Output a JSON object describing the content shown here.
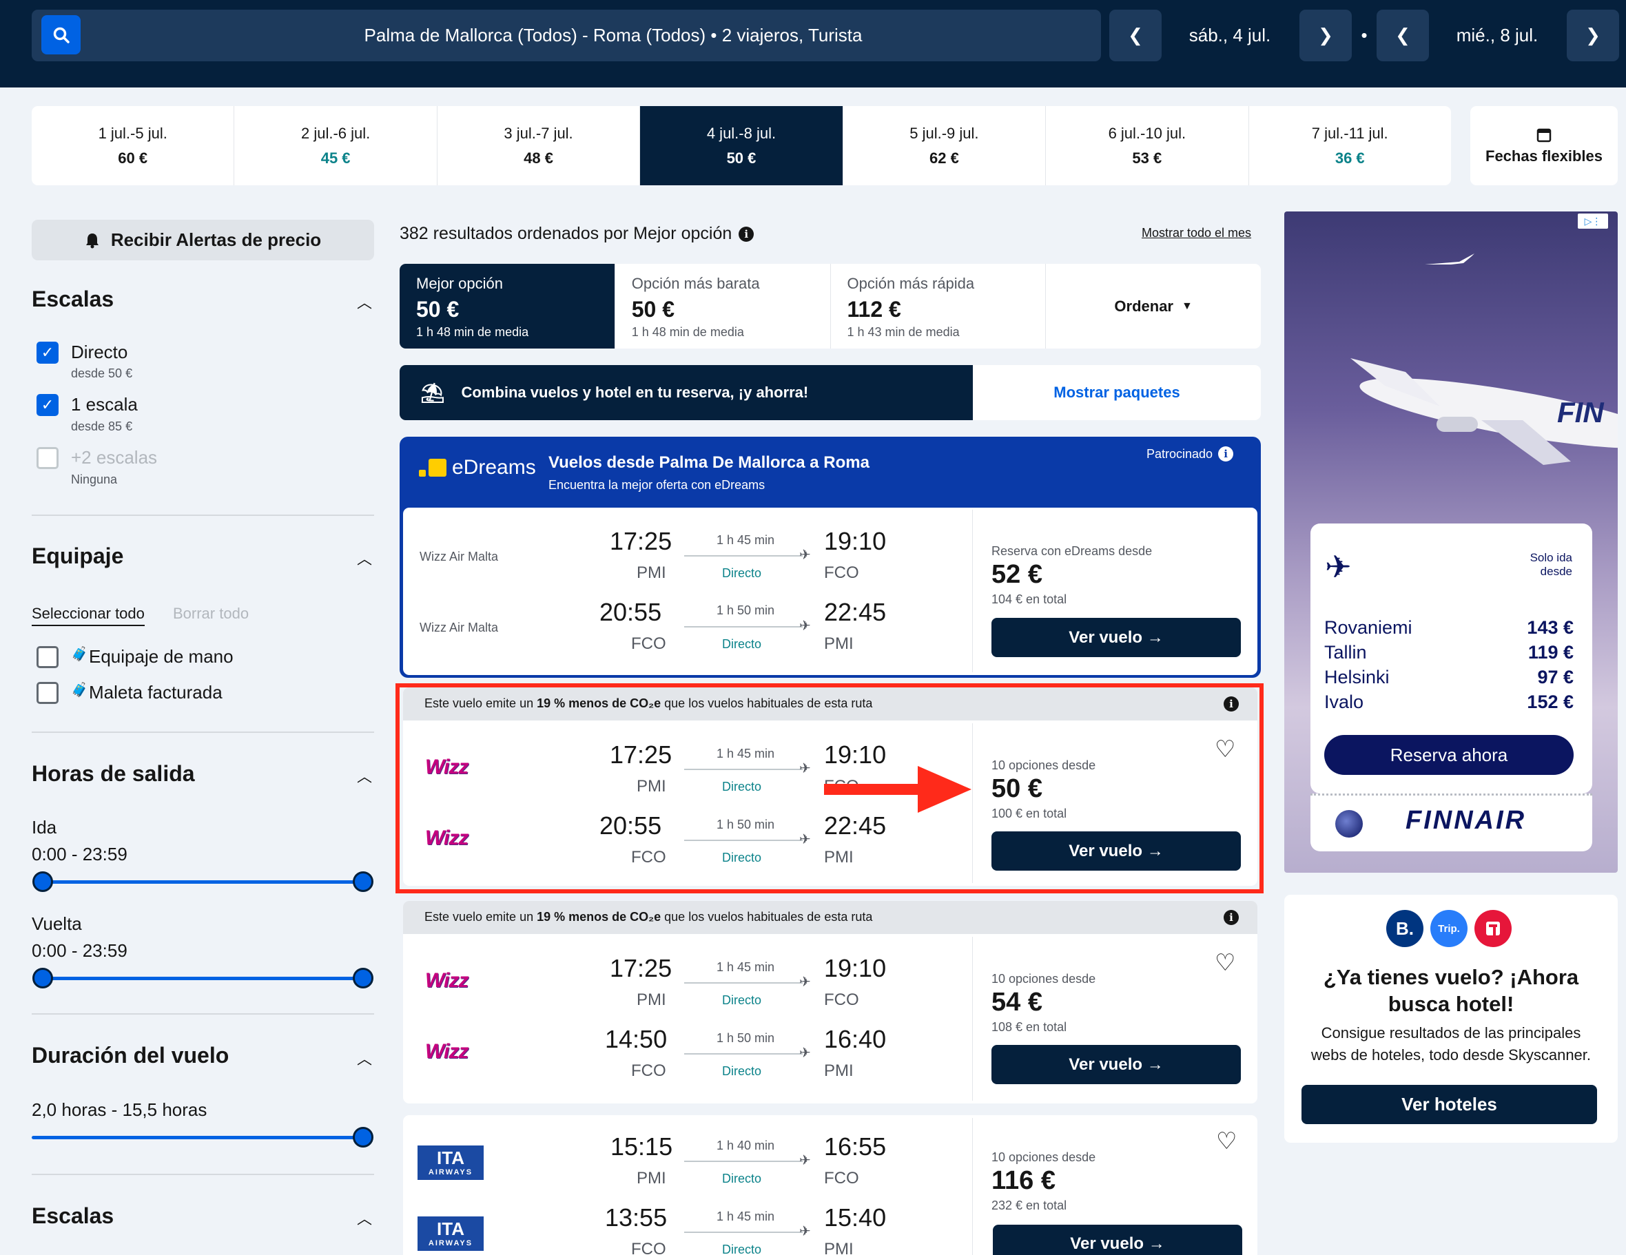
{
  "header": {
    "search_summary": "Palma de Mallorca (Todos) - Roma (Todos)  •  2 viajeros, Turista",
    "depart_date": "sáb., 4 jul.",
    "return_date": "mié., 8 jul.",
    "separator": "•"
  },
  "date_strip": [
    {
      "range": "1 jul.-5 jul.",
      "price": "60 €",
      "cheap": false,
      "active": false
    },
    {
      "range": "2 jul.-6 jul.",
      "price": "45 €",
      "cheap": true,
      "active": false
    },
    {
      "range": "3 jul.-7 jul.",
      "price": "48 €",
      "cheap": false,
      "active": false
    },
    {
      "range": "4 jul.-8 jul.",
      "price": "50 €",
      "cheap": false,
      "active": true
    },
    {
      "range": "5 jul.-9 jul.",
      "price": "62 €",
      "cheap": false,
      "active": false
    },
    {
      "range": "6 jul.-10 jul.",
      "price": "53 €",
      "cheap": false,
      "active": false
    },
    {
      "range": "7 jul.-11 jul.",
      "price": "36 €",
      "cheap": true,
      "active": false
    }
  ],
  "flex_dates_label": "Fechas flexibles",
  "sidebar": {
    "alert_label": "Recibir Alertas de precio",
    "stops_title": "Escalas",
    "stops": [
      {
        "label": "Directo",
        "sub": "desde 50 €",
        "state": "on"
      },
      {
        "label": "1 escala",
        "sub": "desde 85 €",
        "state": "on"
      },
      {
        "label": "+2 escalas",
        "sub": "Ninguna",
        "state": "disabled"
      }
    ],
    "baggage_title": "Equipaje",
    "select_all": "Seleccionar todo",
    "clear_all": "Borrar todo",
    "baggage": [
      {
        "label": "Equipaje de mano"
      },
      {
        "label": "Maleta facturada"
      }
    ],
    "times_title": "Horas de salida",
    "outbound_label": "Ida",
    "outbound_range": "0:00 - 23:59",
    "return_label": "Vuelta",
    "return_range": "0:00 - 23:59",
    "duration_title": "Duración del vuelo",
    "duration_range": "2,0 horas - 15,5 horas",
    "stops2_title": "Escalas"
  },
  "results": {
    "summary": "382 resultados ordenados por Mejor opción",
    "show_month": "Mostrar todo el mes",
    "tabs": [
      {
        "title": "Mejor opción",
        "price": "50 €",
        "sub": "1 h 48 min de media",
        "active": true
      },
      {
        "title": "Opción más barata",
        "price": "50 €",
        "sub": "1 h 48 min de media",
        "active": false
      },
      {
        "title": "Opción más rápida",
        "price": "112 €",
        "sub": "1 h 43 min de media",
        "active": false
      }
    ],
    "sort_label": "Ordenar",
    "combo_text": "Combina vuelos y hotel en tu reserva, ¡y ahorra!",
    "combo_cta": "Mostrar paquetes",
    "sponsored": {
      "brand": "eDreams",
      "title": "Vuelos desde Palma De Mallorca a Roma",
      "subtitle": "Encuentra la mejor oferta con eDreams",
      "tag": "Patrocinado",
      "legs": [
        {
          "airline": "Wizz Air Malta",
          "dep": "17:25",
          "dep_code": "PMI",
          "dur": "1 h 45 min",
          "stops": "Directo",
          "arr": "19:10",
          "arr_code": "FCO"
        },
        {
          "airline": "Wizz Air Malta",
          "dep": "20:55",
          "dep_code": "FCO",
          "dur": "1 h 50 min",
          "stops": "Directo",
          "arr": "22:45",
          "arr_code": "PMI"
        }
      ],
      "price_label": "Reserva con eDreams desde",
      "price": "52 €",
      "total": "104 € en total",
      "cta": "Ver vuelo →"
    },
    "co2_prefix": "Este vuelo emite un ",
    "co2_bold": "19 % menos de CO₂e",
    "co2_suffix": " que los vuelos habituales de esta ruta",
    "cards": [
      {
        "legs": [
          {
            "logo": "wizz",
            "dep": "17:25",
            "dep_code": "PMI",
            "dur": "1 h 45 min",
            "stops": "Directo",
            "arr": "19:10",
            "arr_code": "FCO"
          },
          {
            "logo": "wizz",
            "dep": "20:55",
            "dep_code": "FCO",
            "dur": "1 h 50 min",
            "stops": "Directo",
            "arr": "22:45",
            "arr_code": "PMI"
          }
        ],
        "options": "10 opciones desde",
        "price": "50 €",
        "total": "100 € en total",
        "cta": "Ver vuelo →"
      },
      {
        "legs": [
          {
            "logo": "wizz",
            "dep": "17:25",
            "dep_code": "PMI",
            "dur": "1 h 45 min",
            "stops": "Directo",
            "arr": "19:10",
            "arr_code": "FCO"
          },
          {
            "logo": "wizz",
            "dep": "14:50",
            "dep_code": "FCO",
            "dur": "1 h 50 min",
            "stops": "Directo",
            "arr": "16:40",
            "arr_code": "PMI"
          }
        ],
        "options": "10 opciones desde",
        "price": "54 €",
        "total": "108 € en total",
        "cta": "Ver vuelo →"
      },
      {
        "legs": [
          {
            "logo": "ita",
            "dep": "15:15",
            "dep_code": "PMI",
            "dur": "1 h 40 min",
            "stops": "Directo",
            "arr": "16:55",
            "arr_code": "FCO"
          },
          {
            "logo": "ita",
            "dep": "13:55",
            "dep_code": "FCO",
            "dur": "1 h 45 min",
            "stops": "Directo",
            "arr": "15:40",
            "arr_code": "PMI"
          }
        ],
        "options": "10 opciones desde",
        "price": "116 €",
        "total": "232 € en total",
        "cta": "Ver vuelo →"
      }
    ],
    "wizz_logo_text": "Wizz",
    "ita_logo_text": "ITA",
    "ita_logo_sub": "AIRWAYS"
  },
  "ad": {
    "only_way": "Solo ida",
    "from": "desde",
    "destinations": [
      {
        "city": "Rovaniemi",
        "price": "143 €"
      },
      {
        "city": "Tallin",
        "price": "119 €"
      },
      {
        "city": "Helsinki",
        "price": "97 €"
      },
      {
        "city": "Ivalo",
        "price": "152 €"
      }
    ],
    "cta": "Reserva ahora",
    "brand": "FINNAIR",
    "plane_tail": "FIN"
  },
  "hotel_promo": {
    "title": "¿Ya tienes vuelo? ¡Ahora busca hotel!",
    "body": "Consigue resultados de las principales webs de hoteles, todo desde Skyscanner.",
    "cta": "Ver hoteles",
    "logo_b": "B.",
    "logo_trip": "Trip."
  },
  "colors": {
    "navy": "#05203c",
    "accent_blue": "#0062e3",
    "cheap_teal": "#0c838a",
    "highlight_red": "#ff2a1a"
  }
}
